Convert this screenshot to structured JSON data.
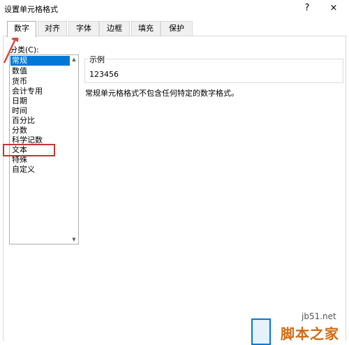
{
  "window": {
    "title": "设置单元格格式",
    "help_icon": "?",
    "close_icon": "×"
  },
  "tabs": [
    {
      "label": "数字",
      "active": true
    },
    {
      "label": "对齐",
      "active": false
    },
    {
      "label": "字体",
      "active": false
    },
    {
      "label": "边框",
      "active": false
    },
    {
      "label": "填充",
      "active": false
    },
    {
      "label": "保护",
      "active": false
    }
  ],
  "category": {
    "label": "分类(C):",
    "items": [
      "常规",
      "数值",
      "货币",
      "会计专用",
      "日期",
      "时间",
      "百分比",
      "分数",
      "科学记数",
      "文本",
      "特殊",
      "自定义"
    ],
    "selected": "常规",
    "highlighted": "文本"
  },
  "sample": {
    "legend": "示例",
    "value": "123456"
  },
  "description": "常规单元格格式不包含任何特定的数字格式。",
  "watermark": {
    "url": "jb51.net",
    "name": "脚本之家"
  },
  "colors": {
    "selection": "#0078d7",
    "highlight_box": "#c83232",
    "arrow": "#d94a3a",
    "watermark": "#d06a14"
  }
}
